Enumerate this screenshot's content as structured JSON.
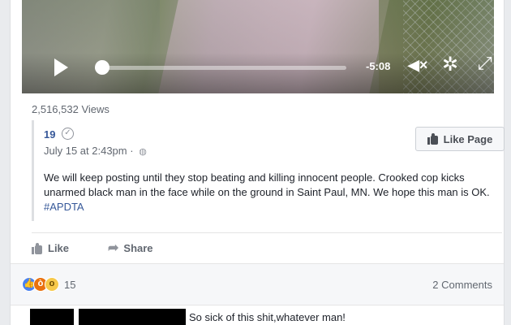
{
  "video": {
    "time_remaining": "-5:08",
    "progress": 0.0
  },
  "views": "2,516,532 Views",
  "shared_post": {
    "page_name": "19",
    "timestamp": "July 15 at 2:43pm ·",
    "like_page_label": "Like Page",
    "text": "We will keep posting until they stop beating and killing innocent people. Crooked cop kicks unarmed black man in the face while on the ground in Saint Paul, MN. We hope this man is OK.",
    "hashtag": "#APDTA"
  },
  "actions": {
    "like_label": "Like",
    "share_label": "Share"
  },
  "reactions": {
    "count": "15",
    "comments_label": "2 Comments"
  },
  "comment": {
    "text": "So sick of this shit,whatever man!"
  },
  "icons": {
    "play": "play-icon",
    "volume": "volume-muted-icon",
    "settings": "gear-icon",
    "fullscreen": "expand-icon",
    "verified": "verified-check-icon",
    "globe": "globe-icon",
    "like": "thumbs-up-icon",
    "share": "share-arrow-icon"
  },
  "colors": {
    "link": "#365899",
    "muted": "#616770",
    "like_reaction": "#4a82f0",
    "angry_reaction": "#e9710f",
    "wow_reaction": "#f7c94a"
  }
}
